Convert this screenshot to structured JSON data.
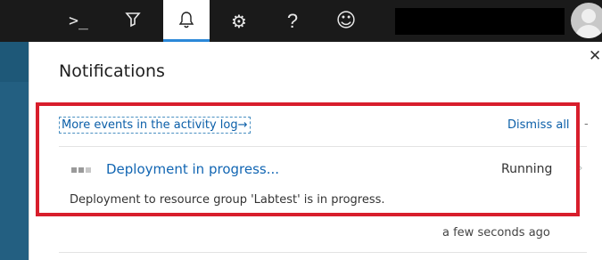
{
  "topbar": {
    "icons": [
      {
        "name": "cloud-shell-icon",
        "glyph": ">_"
      },
      {
        "name": "directory-filter-icon",
        "glyph": "⧩"
      },
      {
        "name": "notifications-bell-icon",
        "glyph": "🔔"
      },
      {
        "name": "settings-gear-icon",
        "glyph": "⚙"
      },
      {
        "name": "help-icon",
        "glyph": "?"
      },
      {
        "name": "feedback-smiley-icon",
        "glyph": "☺"
      }
    ],
    "active_icon": "notifications-bell-icon"
  },
  "panel": {
    "title": "Notifications",
    "close_glyph": "✕",
    "activity_link": "More events in the activity log",
    "activity_arrow": "→",
    "dismiss_all": "Dismiss all",
    "dismiss_dash": "-"
  },
  "notification": {
    "title": "Deployment in progress...",
    "status": "Running",
    "chevron": "›",
    "description": "Deployment to resource group 'Labtest' is in progress.",
    "time": "a few seconds ago"
  },
  "colors": {
    "highlight": "#d81e2c",
    "link": "#0a5ea8",
    "accent": "#2b88d8"
  }
}
